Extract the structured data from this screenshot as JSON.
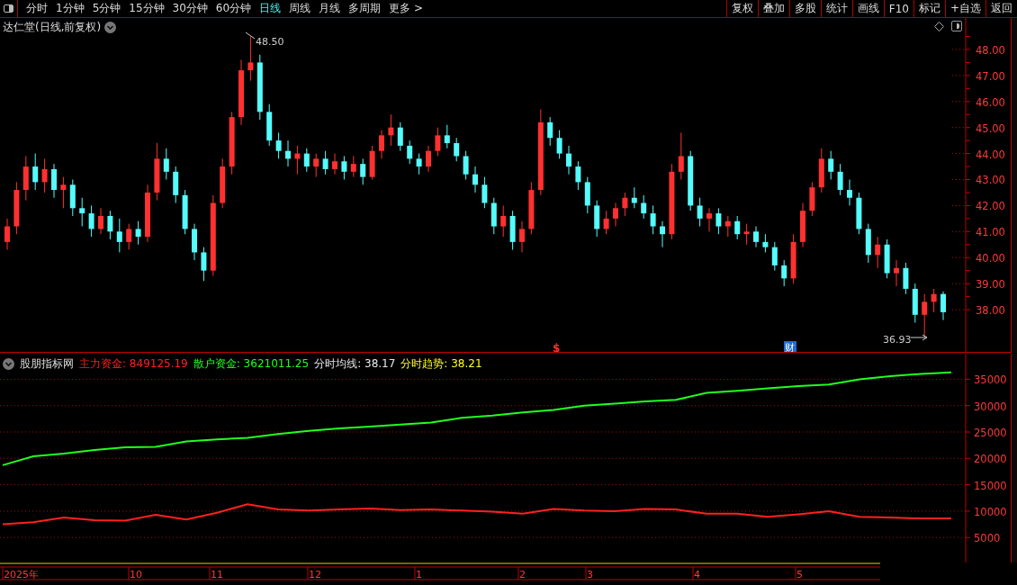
{
  "toolbar": {
    "periods": [
      {
        "label": "分时",
        "selected": false
      },
      {
        "label": "1分钟",
        "selected": false
      },
      {
        "label": "5分钟",
        "selected": false
      },
      {
        "label": "15分钟",
        "selected": false
      },
      {
        "label": "30分钟",
        "selected": false
      },
      {
        "label": "60分钟",
        "selected": false
      },
      {
        "label": "日线",
        "selected": true
      },
      {
        "label": "周线",
        "selected": false
      },
      {
        "label": "月线",
        "selected": false
      },
      {
        "label": "多周期",
        "selected": false
      }
    ],
    "more": "更多 >",
    "buttons": [
      "复权",
      "叠加",
      "多股",
      "统计",
      "画线",
      "F10",
      "标记",
      "+自选",
      "返回"
    ]
  },
  "main_chart": {
    "title": "达仁堂(日线,前复权)",
    "high_label": "48.50",
    "low_label": "36.93",
    "markers": [
      {
        "kind": "signal",
        "text": "$"
      },
      {
        "kind": "badge",
        "text": "财"
      }
    ],
    "chart_data": {
      "type": "candlestick",
      "ylim": [
        36.34,
        49.21
      ],
      "categories": [
        null,
        null,
        null,
        null,
        null,
        null,
        null,
        null,
        null,
        null,
        null,
        null,
        null,
        null,
        null,
        null,
        null,
        null,
        null,
        null,
        null,
        null,
        null,
        null,
        null,
        null,
        null,
        null,
        null,
        null,
        null,
        null,
        null,
        null,
        null,
        null,
        null,
        null,
        null,
        null,
        null,
        null,
        null,
        null,
        null,
        null,
        null,
        null,
        null,
        null,
        null,
        null,
        null,
        null,
        null,
        null,
        null,
        null,
        null,
        null,
        null,
        null,
        null,
        null,
        null,
        null,
        null,
        null,
        null,
        null,
        null,
        null,
        null,
        null,
        null,
        null,
        null,
        null,
        null,
        null,
        null,
        null,
        null,
        null,
        null,
        null,
        null,
        null,
        null,
        null,
        null,
        null,
        null,
        null,
        null,
        null,
        null,
        null,
        null,
        null,
        null
      ],
      "yticks": [
        {
          "value": 48,
          "label": "48.00"
        },
        {
          "value": 47,
          "label": "47.00"
        },
        {
          "value": 46,
          "label": "46.00"
        },
        {
          "value": 45,
          "label": "45.00"
        },
        {
          "value": 44,
          "label": "44.00"
        },
        {
          "value": 43,
          "label": "43.00"
        },
        {
          "value": 42,
          "label": "42.00"
        },
        {
          "value": 41,
          "label": "41.00"
        },
        {
          "value": 40,
          "label": "40.00"
        },
        {
          "value": 39,
          "label": "39.00"
        },
        {
          "value": 38,
          "label": "38.00"
        }
      ],
      "ohlc": [
        [
          40.6,
          41.5,
          40.3,
          41.2
        ],
        [
          41.2,
          42.9,
          40.9,
          42.6
        ],
        [
          42.6,
          43.9,
          42.2,
          43.5
        ],
        [
          43.5,
          44.0,
          42.6,
          42.9
        ],
        [
          42.9,
          43.8,
          42.5,
          43.4
        ],
        [
          43.4,
          43.6,
          42.3,
          42.6
        ],
        [
          42.6,
          43.1,
          41.9,
          42.8
        ],
        [
          42.8,
          43.0,
          41.6,
          41.9
        ],
        [
          41.9,
          42.3,
          41.2,
          41.7
        ],
        [
          41.7,
          42.0,
          40.8,
          41.1
        ],
        [
          41.1,
          41.9,
          40.9,
          41.6
        ],
        [
          41.6,
          41.8,
          40.7,
          41.0
        ],
        [
          41.0,
          41.5,
          40.2,
          40.6
        ],
        [
          40.6,
          41.3,
          40.3,
          41.1
        ],
        [
          41.1,
          41.4,
          40.5,
          40.8
        ],
        [
          40.8,
          42.8,
          40.6,
          42.5
        ],
        [
          42.5,
          44.4,
          42.2,
          43.8
        ],
        [
          43.8,
          44.2,
          43.0,
          43.3
        ],
        [
          43.3,
          43.5,
          42.1,
          42.4
        ],
        [
          42.4,
          42.6,
          40.9,
          41.1
        ],
        [
          41.1,
          41.3,
          39.9,
          40.2
        ],
        [
          40.2,
          40.4,
          39.1,
          39.5
        ],
        [
          39.5,
          42.4,
          39.3,
          42.1
        ],
        [
          42.1,
          43.8,
          41.9,
          43.5
        ],
        [
          43.5,
          45.6,
          43.2,
          45.4
        ],
        [
          45.4,
          47.6,
          45.1,
          47.2
        ],
        [
          47.2,
          48.5,
          46.8,
          47.5
        ],
        [
          47.5,
          47.8,
          45.3,
          45.6
        ],
        [
          45.6,
          45.9,
          44.3,
          44.5
        ],
        [
          44.5,
          44.8,
          43.8,
          44.1
        ],
        [
          44.1,
          44.5,
          43.5,
          43.8
        ],
        [
          43.8,
          44.3,
          43.2,
          44.0
        ],
        [
          44.0,
          44.2,
          43.3,
          43.5
        ],
        [
          43.5,
          44.0,
          43.1,
          43.8
        ],
        [
          43.8,
          44.1,
          43.2,
          43.4
        ],
        [
          43.4,
          44.0,
          43.2,
          43.7
        ],
        [
          43.7,
          43.9,
          43.0,
          43.3
        ],
        [
          43.3,
          43.9,
          43.1,
          43.6
        ],
        [
          43.6,
          43.8,
          42.8,
          43.1
        ],
        [
          43.1,
          44.3,
          43.0,
          44.1
        ],
        [
          44.1,
          44.9,
          43.8,
          44.7
        ],
        [
          44.7,
          45.5,
          44.3,
          45.0
        ],
        [
          45.0,
          45.2,
          44.1,
          44.3
        ],
        [
          44.3,
          44.5,
          43.6,
          43.8
        ],
        [
          43.8,
          44.0,
          43.2,
          43.5
        ],
        [
          43.5,
          44.3,
          43.3,
          44.1
        ],
        [
          44.1,
          45.0,
          43.9,
          44.7
        ],
        [
          44.7,
          45.1,
          44.2,
          44.4
        ],
        [
          44.4,
          44.6,
          43.7,
          43.9
        ],
        [
          43.9,
          44.1,
          43.0,
          43.2
        ],
        [
          43.2,
          43.5,
          42.5,
          42.8
        ],
        [
          42.8,
          43.1,
          41.9,
          42.1
        ],
        [
          42.1,
          42.3,
          40.9,
          41.2
        ],
        [
          41.2,
          42.0,
          40.8,
          41.6
        ],
        [
          41.6,
          41.8,
          40.3,
          40.6
        ],
        [
          40.6,
          41.4,
          40.2,
          41.1
        ],
        [
          41.1,
          42.9,
          40.9,
          42.6
        ],
        [
          42.6,
          45.7,
          42.4,
          45.2
        ],
        [
          45.2,
          45.4,
          44.3,
          44.6
        ],
        [
          44.6,
          44.9,
          43.8,
          44.0
        ],
        [
          44.0,
          44.3,
          43.2,
          43.5
        ],
        [
          43.5,
          43.7,
          42.6,
          42.9
        ],
        [
          42.9,
          43.1,
          41.7,
          42.0
        ],
        [
          42.0,
          42.2,
          40.8,
          41.1
        ],
        [
          41.1,
          41.8,
          40.9,
          41.5
        ],
        [
          41.5,
          42.1,
          41.2,
          41.9
        ],
        [
          41.9,
          42.5,
          41.6,
          42.3
        ],
        [
          42.3,
          42.7,
          41.9,
          42.1
        ],
        [
          42.1,
          42.4,
          41.5,
          41.7
        ],
        [
          41.7,
          42.0,
          40.9,
          41.2
        ],
        [
          41.2,
          41.4,
          40.4,
          40.9
        ],
        [
          40.9,
          43.6,
          40.7,
          43.3
        ],
        [
          43.3,
          44.8,
          43.0,
          43.9
        ],
        [
          43.9,
          44.1,
          41.8,
          42.0
        ],
        [
          42.0,
          42.3,
          41.2,
          41.5
        ],
        [
          41.5,
          41.9,
          41.0,
          41.7
        ],
        [
          41.7,
          41.9,
          40.9,
          41.2
        ],
        [
          41.2,
          41.6,
          40.8,
          41.4
        ],
        [
          41.4,
          41.6,
          40.7,
          40.9
        ],
        [
          40.9,
          41.3,
          40.5,
          41.0
        ],
        [
          41.0,
          41.2,
          40.4,
          40.6
        ],
        [
          40.6,
          40.9,
          40.2,
          40.4
        ],
        [
          40.4,
          40.6,
          39.5,
          39.7
        ],
        [
          39.7,
          39.9,
          38.9,
          39.2
        ],
        [
          39.2,
          40.9,
          39.0,
          40.6
        ],
        [
          40.6,
          42.1,
          40.4,
          41.8
        ],
        [
          41.8,
          42.9,
          41.6,
          42.7
        ],
        [
          42.7,
          44.2,
          42.5,
          43.8
        ],
        [
          43.8,
          44.1,
          43.0,
          43.3
        ],
        [
          43.3,
          43.6,
          42.4,
          42.6
        ],
        [
          42.6,
          43.0,
          42.0,
          42.3
        ],
        [
          42.3,
          42.5,
          40.9,
          41.1
        ],
        [
          41.1,
          41.3,
          39.8,
          40.1
        ],
        [
          40.1,
          40.8,
          39.6,
          40.5
        ],
        [
          40.5,
          40.7,
          39.2,
          39.4
        ],
        [
          39.4,
          39.9,
          38.9,
          39.6
        ],
        [
          39.6,
          39.8,
          38.6,
          38.8
        ],
        [
          38.8,
          39.0,
          37.5,
          37.8
        ],
        [
          37.8,
          38.6,
          36.93,
          38.3
        ],
        [
          38.3,
          38.8,
          37.9,
          38.6
        ],
        [
          38.6,
          38.7,
          37.6,
          37.9
        ]
      ]
    }
  },
  "indicator": {
    "name": "股朋指标网",
    "legend": [
      {
        "value": "849125.19"
      },
      {
        "value": "3621011.25"
      },
      {
        "label": "分时均线:",
        "value": "38.17",
        "color": "#e8e8e8"
      },
      {
        "label": "分时趋势:",
        "value": "38.21",
        "color": "#ffff20"
      }
    ],
    "chart_data": {
      "type": "line",
      "grid": true,
      "ylim": [
        255,
        39846
      ],
      "yticks": [
        5000,
        10000,
        15000,
        20000,
        25000,
        30000,
        35000
      ],
      "series": [
        {
          "name": "主力资金:",
          "color": "#ff2020",
          "values": [
            7500,
            7900,
            8800,
            8300,
            8200,
            9300,
            8400,
            9700,
            11300,
            10300,
            10100,
            10300,
            10500,
            10200,
            10300,
            10100,
            9900,
            9500,
            10400,
            10100,
            10000,
            10400,
            10300,
            9500,
            9500,
            8900,
            9400,
            10000,
            8900,
            8800,
            8600,
            8600
          ]
        },
        {
          "name": "散户资金:",
          "color": "#20ff20",
          "values": [
            18700,
            20400,
            20900,
            21600,
            22100,
            22200,
            23200,
            23600,
            23900,
            24600,
            25200,
            25700,
            26000,
            26400,
            26800,
            27700,
            28100,
            28700,
            29200,
            30000,
            30400,
            30800,
            31100,
            32400,
            32800,
            33300,
            33700,
            34000,
            35000,
            35600,
            36000,
            36300
          ]
        }
      ]
    }
  },
  "date_axis": [
    "2025年",
    "10",
    "11",
    "12",
    "1",
    "2",
    "3",
    "4",
    "5"
  ]
}
